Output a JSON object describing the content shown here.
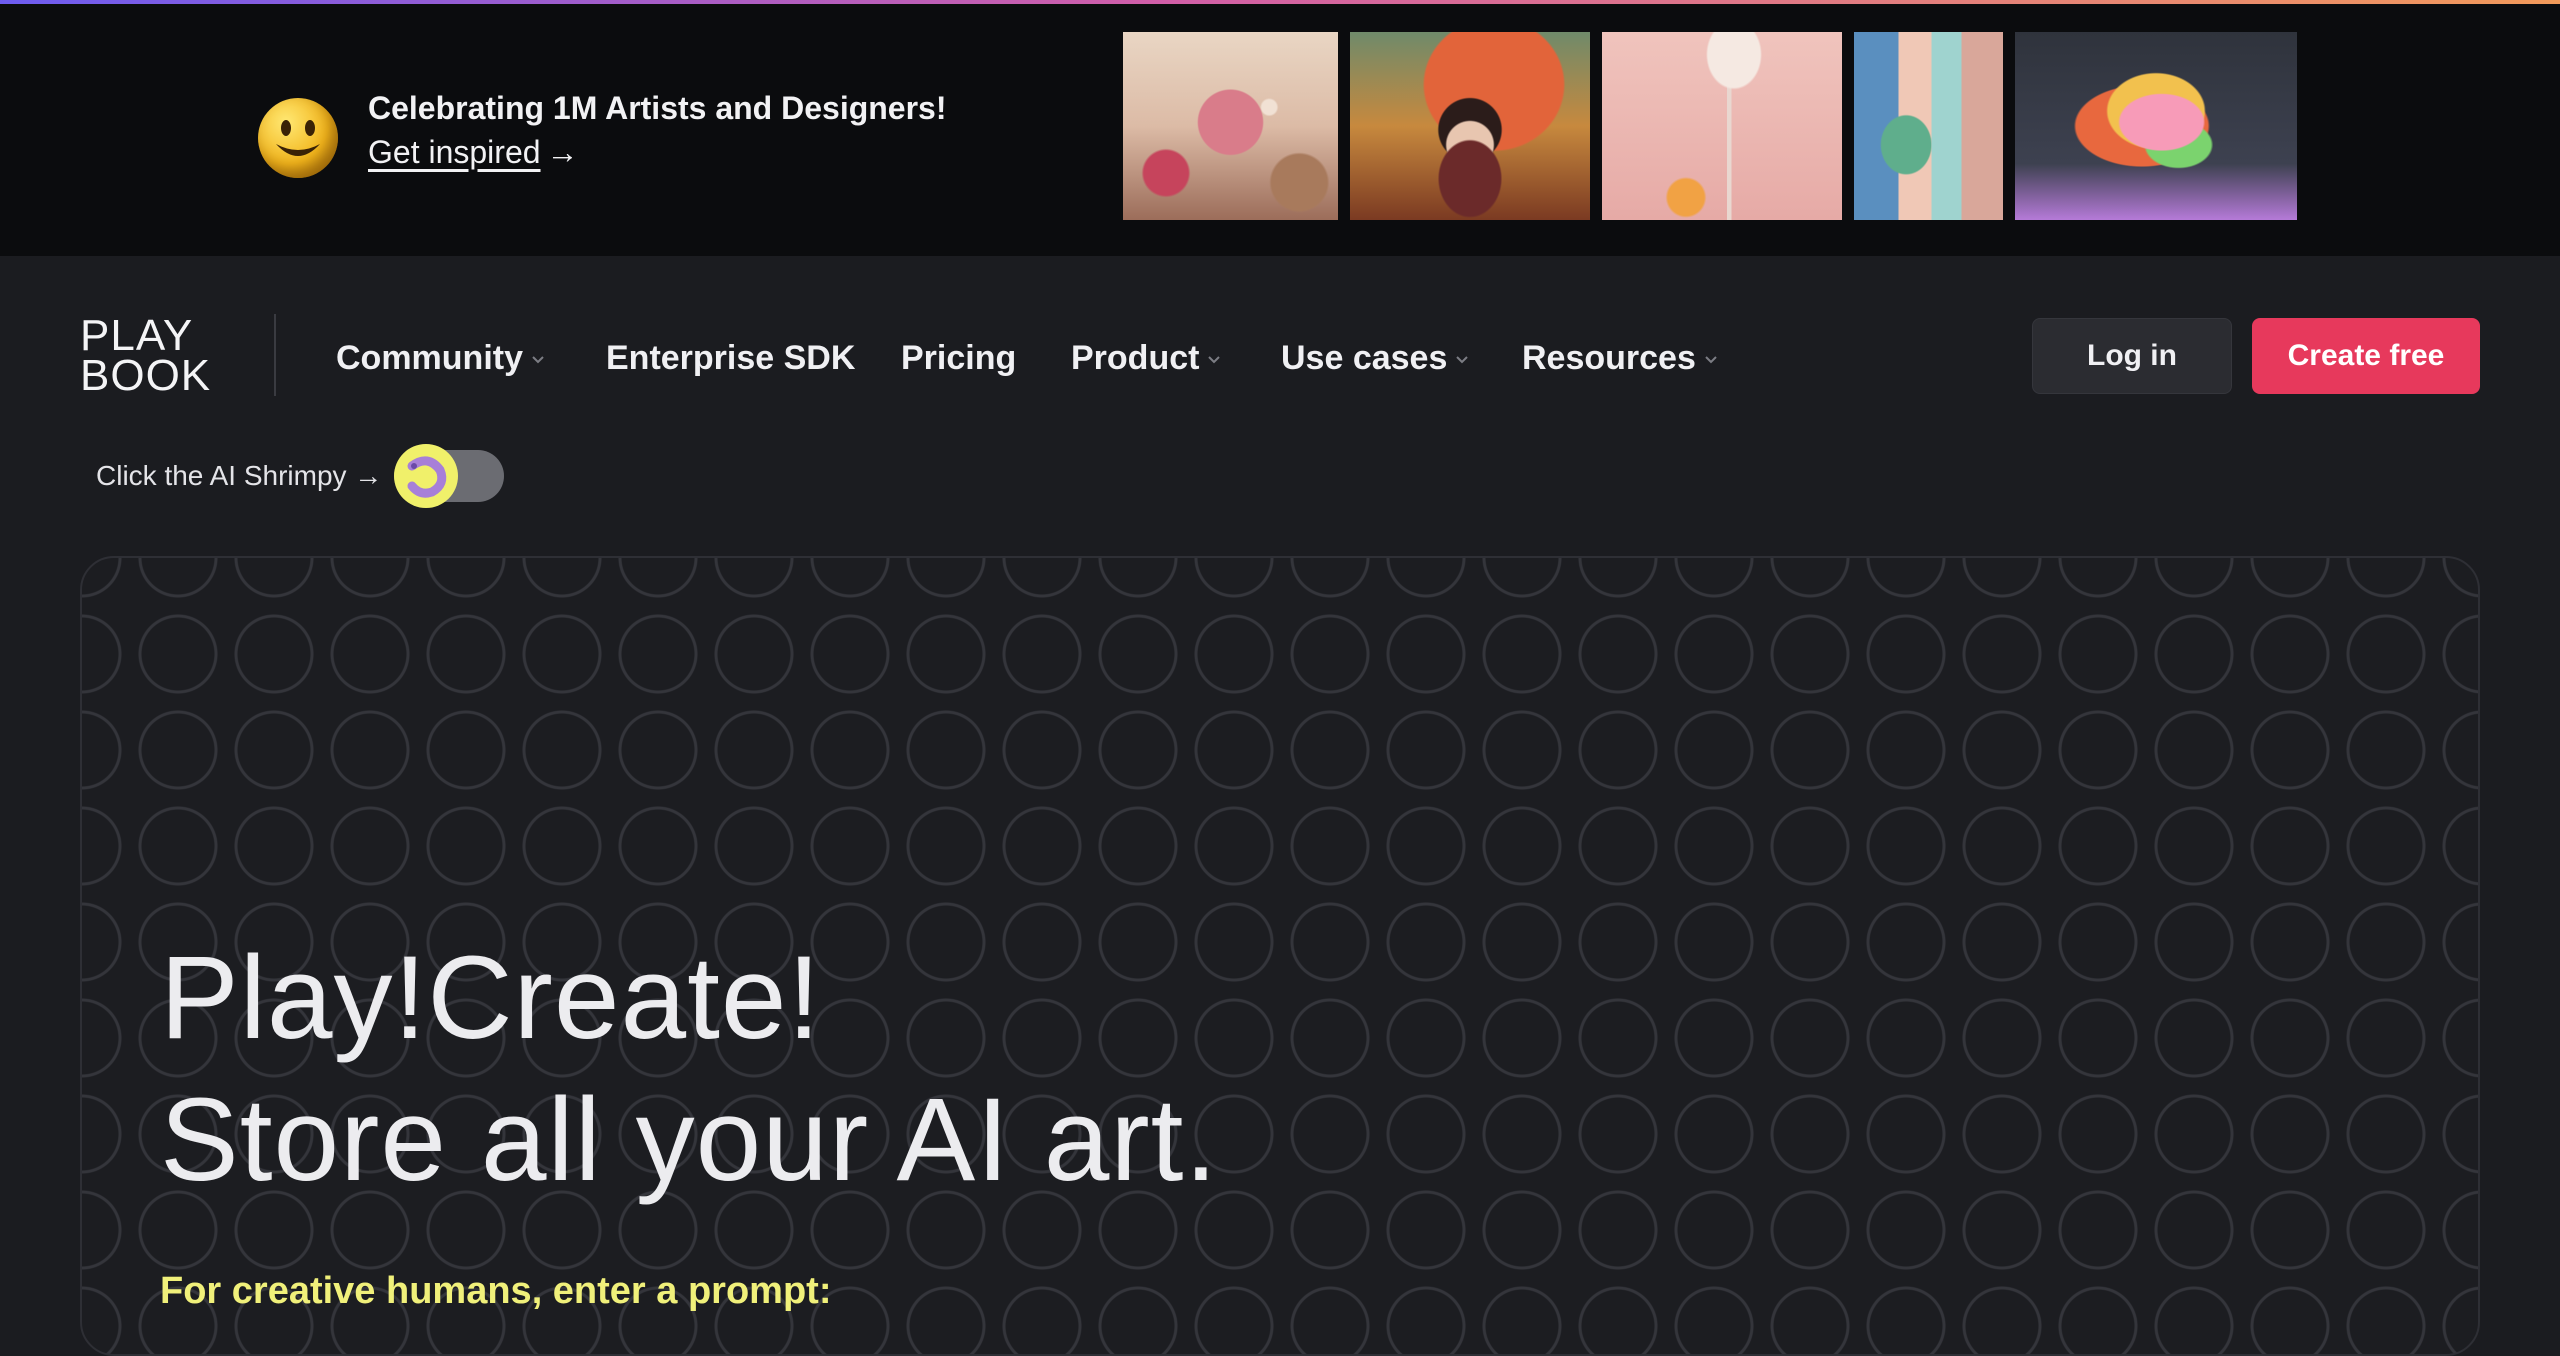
{
  "banner": {
    "title": "Celebrating 1M Artists and Designers!",
    "link_text": "Get inspired ",
    "link_arrow": "→",
    "thumbnails": [
      "thumb-1",
      "thumb-2",
      "thumb-3",
      "thumb-4",
      "thumb-5"
    ]
  },
  "nav": {
    "logo_line1": "PLAY",
    "logo_line2": "BOOK",
    "items": [
      {
        "label": "Community",
        "dropdown": true
      },
      {
        "label": "Enterprise SDK",
        "dropdown": false
      },
      {
        "label": "Pricing",
        "dropdown": false
      },
      {
        "label": "Product",
        "dropdown": true
      },
      {
        "label": "Use cases",
        "dropdown": true
      },
      {
        "label": "Resources",
        "dropdown": true
      }
    ],
    "login_label": "Log in",
    "create_label": "Create free"
  },
  "shrimpy": {
    "label": "Click the AI Shrimpy →",
    "toggle_on": false
  },
  "hero": {
    "line1": "Play!Create!",
    "line2": "Store all your AI art.",
    "prompt_label": "For creative humans, enter a prompt:"
  },
  "colors": {
    "accent": "#e7395c",
    "highlight": "#f0f07a",
    "background": "#1b1c20",
    "banner_background": "#0b0c0e"
  }
}
